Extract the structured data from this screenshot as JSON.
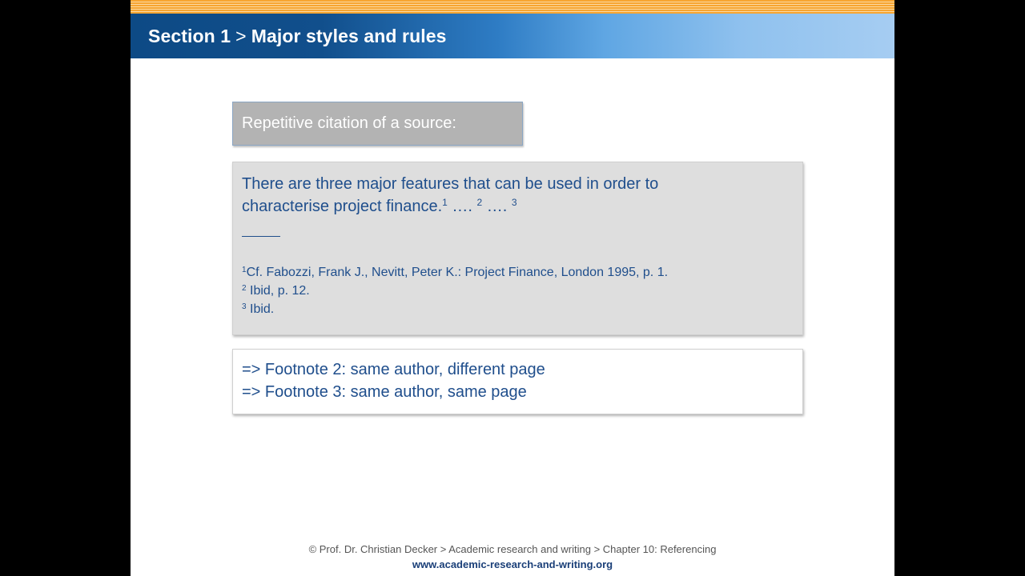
{
  "header": {
    "section": "Section 1",
    "separator": ">",
    "title": "Major styles and rules"
  },
  "label_box": {
    "text": "Repetitive citation of a source:"
  },
  "example": {
    "line1": "There are three major features that can be used in order to",
    "line2": "characterise project finance.",
    "marker1": "1",
    "dots1": " …. ",
    "marker2": "2",
    "dots2": " …. ",
    "marker3": "3",
    "footnotes": [
      {
        "num": "1",
        "text": "Cf. Fabozzi, Frank J., Nevitt, Peter K.: Project Finance, London 1995, p. 1."
      },
      {
        "num": "2",
        "text": " Ibid, p. 12."
      },
      {
        "num": "3",
        "text": " Ibid."
      }
    ]
  },
  "conclusion": {
    "line1": "=> Footnote 2: same author, different page",
    "line2": "=> Footnote 3: same author, same page"
  },
  "footer": {
    "credit": "© Prof. Dr. Christian Decker > Academic research and writing > Chapter 10: Referencing",
    "url": "www.academic-research-and-writing.org"
  },
  "colors": {
    "text_blue": "#1f4e8c",
    "header_dark": "#0d4a85",
    "header_light": "#a6cdf2",
    "stripe_orange": "#f7a530",
    "label_gray": "#b3b3b3",
    "example_bg": "#dedede"
  }
}
